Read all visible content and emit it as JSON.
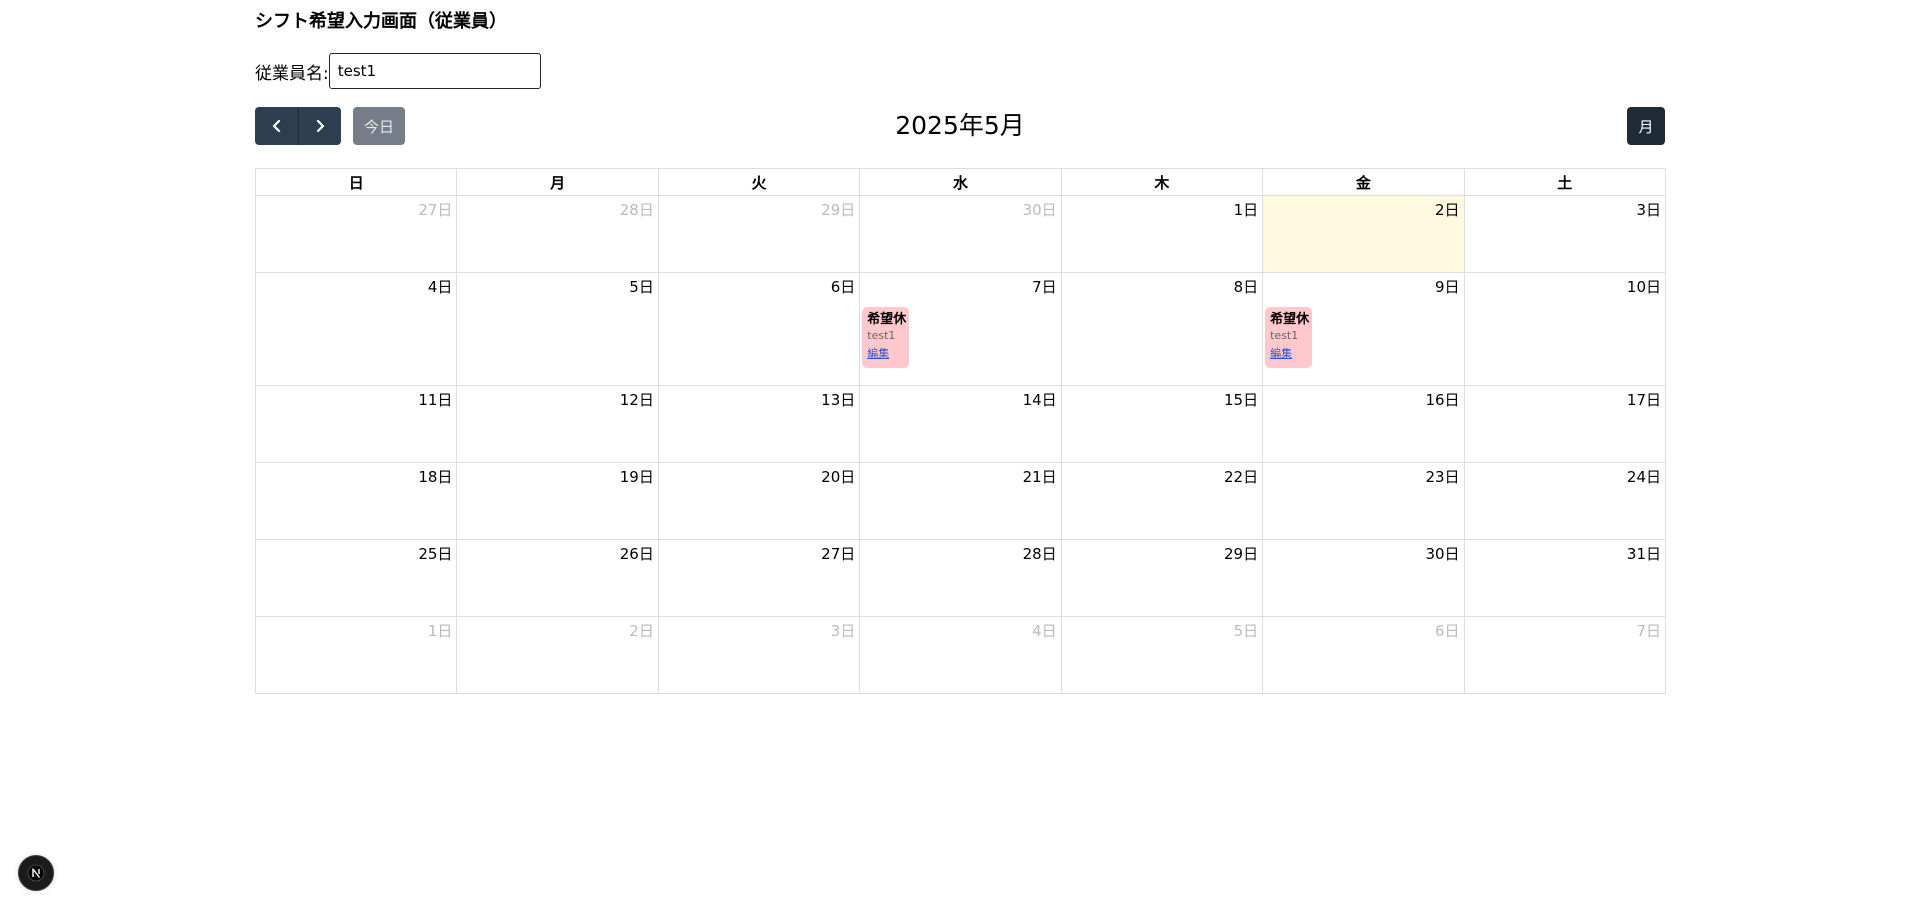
{
  "page": {
    "title": "シフト希望入力画面（従業員）"
  },
  "employee": {
    "label": "従業員名:",
    "value": "test1"
  },
  "toolbar": {
    "prev_icon": "chevron-left-icon",
    "next_icon": "chevron-right-icon",
    "today_label": "今日",
    "month_title": "2025年5月",
    "view_label": "月"
  },
  "calendar": {
    "weekdays": [
      "日",
      "月",
      "火",
      "水",
      "木",
      "金",
      "土"
    ],
    "weeks": [
      [
        "27日",
        "28日",
        "29日",
        "30日",
        "1日",
        "2日",
        "3日"
      ],
      [
        "4日",
        "5日",
        "6日",
        "7日",
        "8日",
        "9日",
        "10日"
      ],
      [
        "11日",
        "12日",
        "13日",
        "14日",
        "15日",
        "16日",
        "17日"
      ],
      [
        "18日",
        "19日",
        "20日",
        "21日",
        "22日",
        "23日",
        "24日"
      ],
      [
        "25日",
        "26日",
        "27日",
        "28日",
        "29日",
        "30日",
        "31日"
      ],
      [
        "1日",
        "2日",
        "3日",
        "4日",
        "5日",
        "6日",
        "7日"
      ]
    ],
    "events": [
      {
        "title": "希望休",
        "name": "test1",
        "edit": "編集"
      },
      {
        "title": "希望休",
        "name": "test1",
        "edit": "編集"
      }
    ]
  },
  "badge": {
    "letter": "N",
    "icon": "nextjs-logo-icon"
  },
  "colors": {
    "nav_button": "#2c3e50",
    "today_button": "#757d88",
    "view_button": "#1e2b37",
    "today_cell": "#fffadf",
    "event_bg": "#ffc8cc",
    "edit_link": "#2b52d9"
  }
}
